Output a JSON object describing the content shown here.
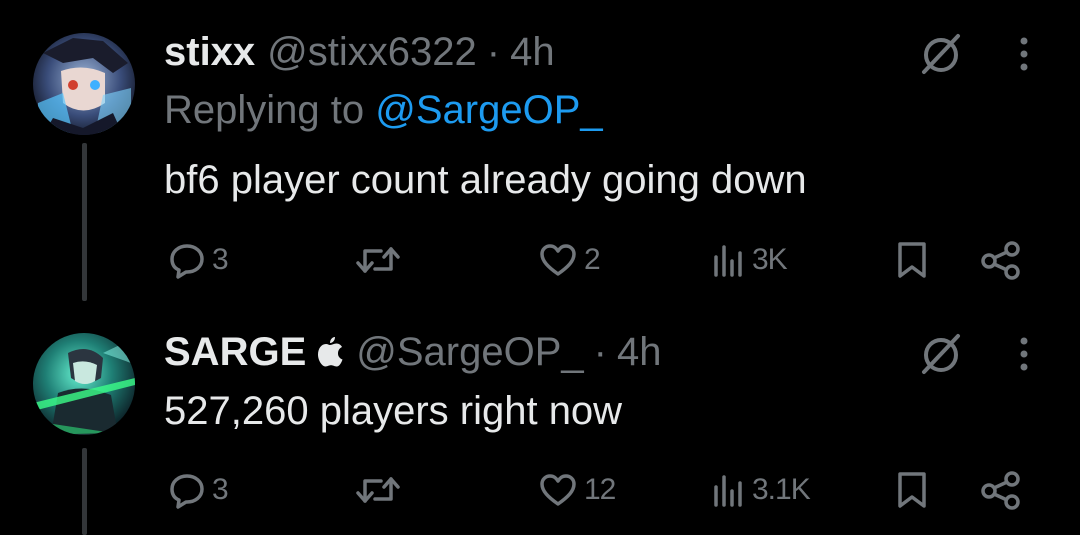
{
  "tweets": [
    {
      "name": "stixx",
      "handle": "@stixx6322",
      "separator": "·",
      "time": "4h",
      "replying_prefix": "Replying to",
      "replying_to": "@SargeOP_",
      "text": "bf6 player count already going down",
      "stats": {
        "replies": "3",
        "reposts": "",
        "likes": "2",
        "views": "3K"
      },
      "icons": [
        "grok-icon",
        "more-icon",
        "reply-icon",
        "repost-icon",
        "like-icon",
        "views-icon",
        "bookmark-icon",
        "share-icon"
      ]
    },
    {
      "name": "SARGE",
      "handle": "@SargeOP_",
      "separator": "·",
      "time": "4h",
      "text": "527,260 players right now",
      "stats": {
        "replies": "3",
        "reposts": "",
        "likes": "12",
        "views": "3.1K"
      },
      "icons": [
        "apple-icon",
        "grok-icon",
        "more-icon",
        "reply-icon",
        "repost-icon",
        "like-icon",
        "views-icon",
        "bookmark-icon",
        "share-icon"
      ]
    }
  ],
  "colors": {
    "background": "#000000",
    "text": "#e7e9ea",
    "muted": "#71767b",
    "link": "#1d9bf0",
    "thread_line": "#333639"
  }
}
